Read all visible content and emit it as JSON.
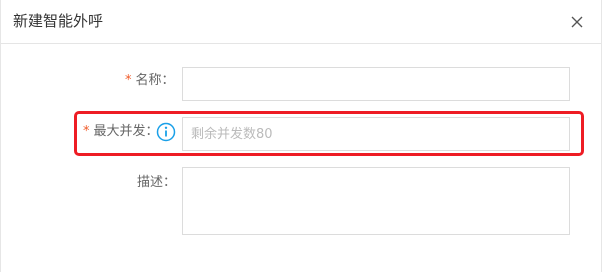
{
  "dialog": {
    "title": "新建智能外呼",
    "close_icon": "close-icon"
  },
  "form": {
    "name": {
      "required_mark": "*",
      "label": "名称：",
      "value": "",
      "placeholder": ""
    },
    "max_concurrency": {
      "required_mark": "*",
      "label": "最大并发：",
      "value": "",
      "placeholder": "剩余并发数80",
      "info_icon": "info-icon"
    },
    "description": {
      "label": "描述：",
      "value": ""
    }
  },
  "colors": {
    "required": "#f05a28",
    "highlight": "#ee1c24",
    "info": "#1aa0e8"
  }
}
